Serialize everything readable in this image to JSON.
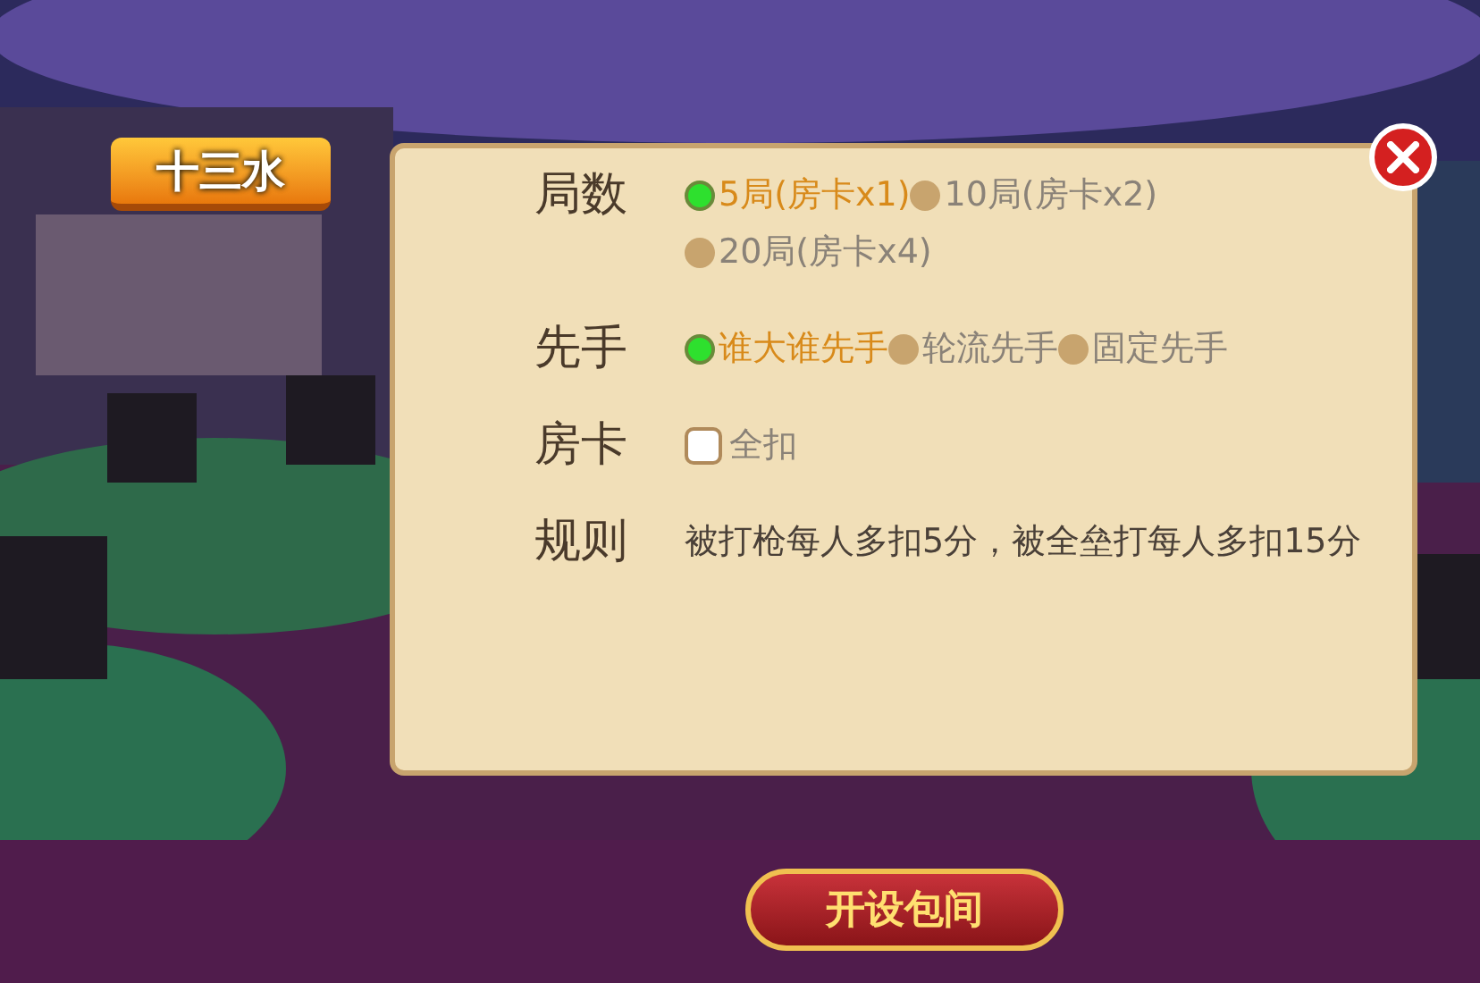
{
  "title_tab": {
    "label": "十三水"
  },
  "rows": [
    {
      "kind": "radio",
      "label": "局数",
      "options": [
        {
          "text": "5局(房卡x1)",
          "selected": true
        },
        {
          "text": "10局(房卡x2)",
          "selected": false
        },
        {
          "text": "20局(房卡x4)",
          "selected": false
        }
      ]
    },
    {
      "kind": "radio",
      "label": "先手",
      "options": [
        {
          "text": "谁大谁先手",
          "selected": true
        },
        {
          "text": "轮流先手",
          "selected": false
        },
        {
          "text": "固定先手",
          "selected": false
        }
      ]
    },
    {
      "kind": "checkbox",
      "label": "房卡",
      "options": [
        {
          "text": "全扣",
          "checked": false
        }
      ]
    },
    {
      "kind": "text",
      "label": "规则",
      "text": "被打枪每人多扣5分，被全垒打每人多扣15分"
    }
  ],
  "create_button": {
    "label": "开设包间"
  }
}
